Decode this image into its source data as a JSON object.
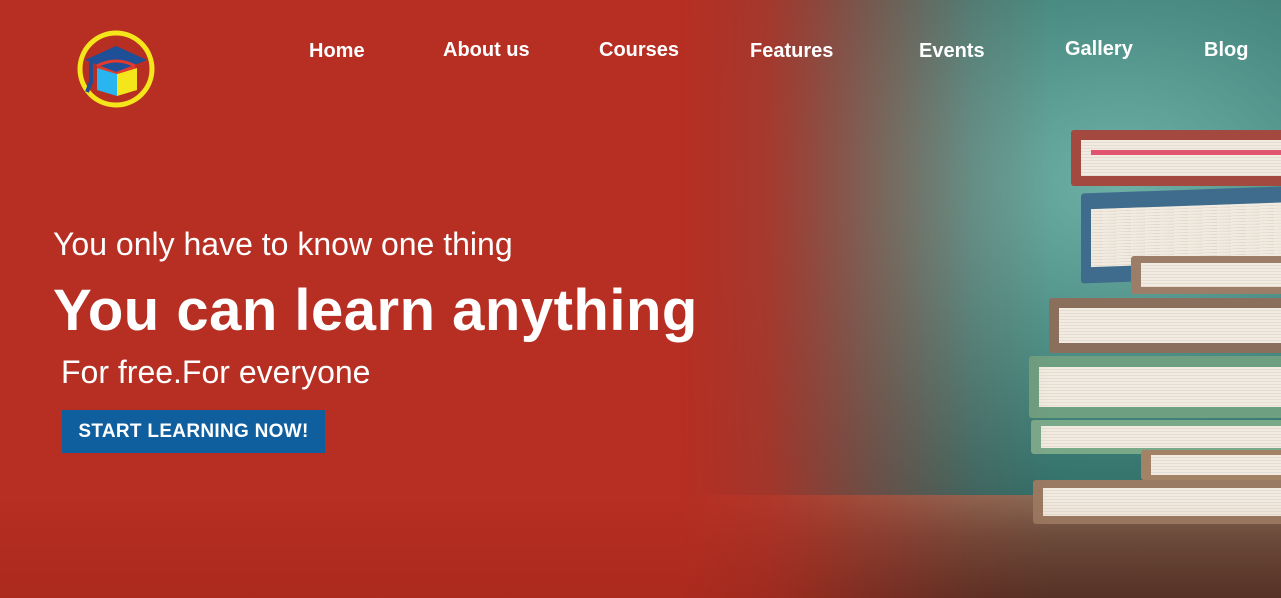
{
  "nav": {
    "logo_icon": "graduation-cap-box-logo",
    "items": [
      {
        "label": "Home"
      },
      {
        "label": "About us"
      },
      {
        "label": "Courses"
      },
      {
        "label": "Features"
      },
      {
        "label": "Events"
      },
      {
        "label": "Gallery"
      },
      {
        "label": "Blog"
      }
    ]
  },
  "hero": {
    "tagline": "You only have to know one thing",
    "headline": "You can learn anything",
    "subline": "For free.For everyone",
    "cta_label": "START LEARNING NOW!",
    "background_image": "stack-of-books-on-table-against-chalkboard"
  },
  "colors": {
    "primary_red": "#b72e22",
    "cta_blue": "#0f5f9e",
    "logo_yellow": "#f5e51b",
    "text": "#ffffff"
  }
}
